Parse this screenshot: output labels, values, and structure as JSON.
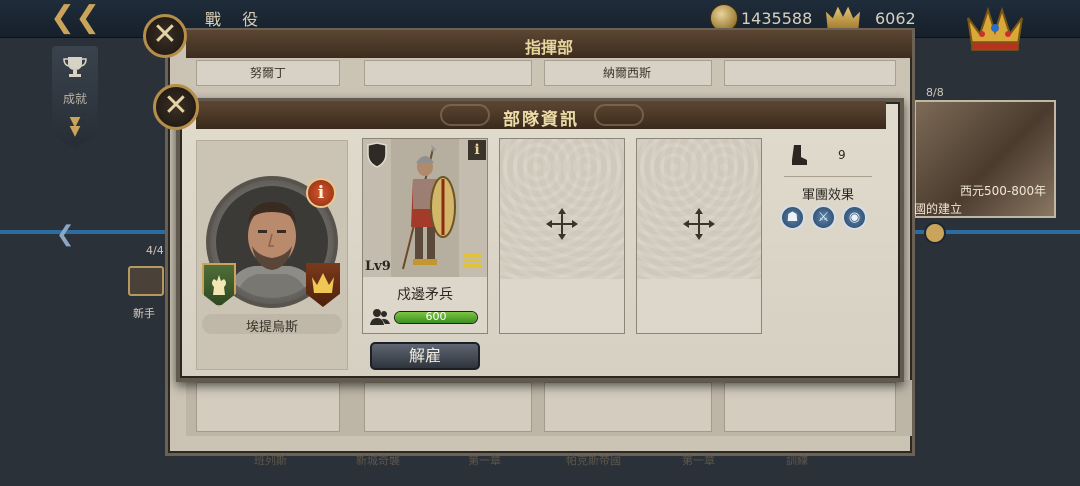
{
  "topbar": {
    "title": "戰 役",
    "coins": "1435588",
    "gems": "6062"
  },
  "sidebar": {
    "achievements_label": "成就"
  },
  "background": {
    "count_left": "4/4",
    "newbie_label": "新手",
    "count_right": "8/8",
    "battle_year": "西元500-800年",
    "battle_caption": "國的建立"
  },
  "command_window": {
    "title": "指揮部",
    "slots": [
      "努爾丁",
      "納爾西斯"
    ],
    "bottom_labels": [
      "班列斯",
      "新城奇襲",
      "第一章",
      "帕克斯帝國",
      "第一章",
      "訓練"
    ]
  },
  "unit_panel": {
    "title": "部隊資訊",
    "commander": {
      "name": "埃提烏斯",
      "info_badge": "i"
    },
    "unit": {
      "level": "Lv9",
      "name": "戍邊矛兵",
      "troops": "600",
      "troop_fill": 1.0,
      "info_badge": "i"
    },
    "dismiss_label": "解雇",
    "movement_value": "9",
    "legion_effect_label": "軍團效果",
    "effect_icons": [
      "helmet-icon",
      "crossed-axes-icon",
      "shield-crest-icon"
    ]
  },
  "colors": {
    "header_bar": "#3d2c1e",
    "title_gold": "#eddca8",
    "troop_bar_green": "#3c8f1f",
    "info_badge_red": "#8e2b12",
    "rail_blue": "#2d6ca0"
  }
}
